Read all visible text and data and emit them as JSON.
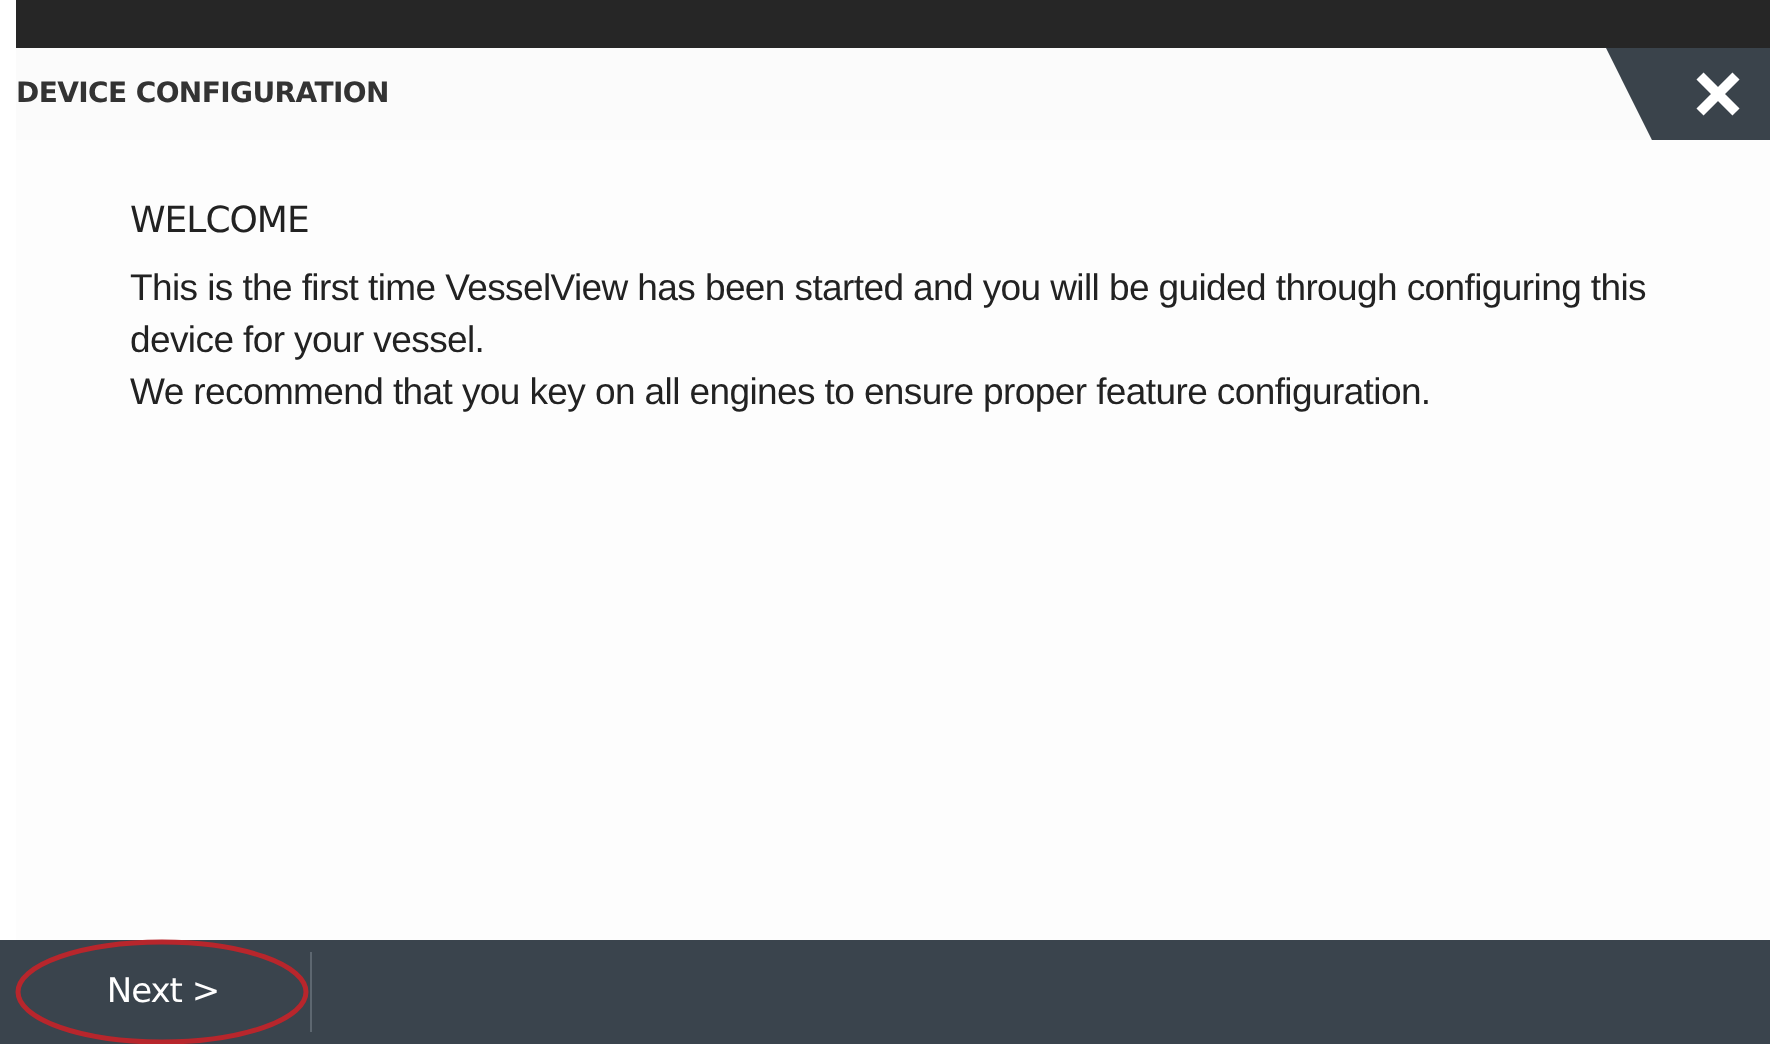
{
  "dialog": {
    "title": "DEVICE CONFIGURATION"
  },
  "content": {
    "heading": "WELCOME",
    "paragraphs": [
      "This is the first time VesselView has been started and you will be guided through configuring this device for your vessel.",
      "We recommend that you key on all engines to ensure proper feature configuration."
    ]
  },
  "footer": {
    "buttons": [
      {
        "label": "Next >",
        "highlighted": true
      }
    ]
  }
}
